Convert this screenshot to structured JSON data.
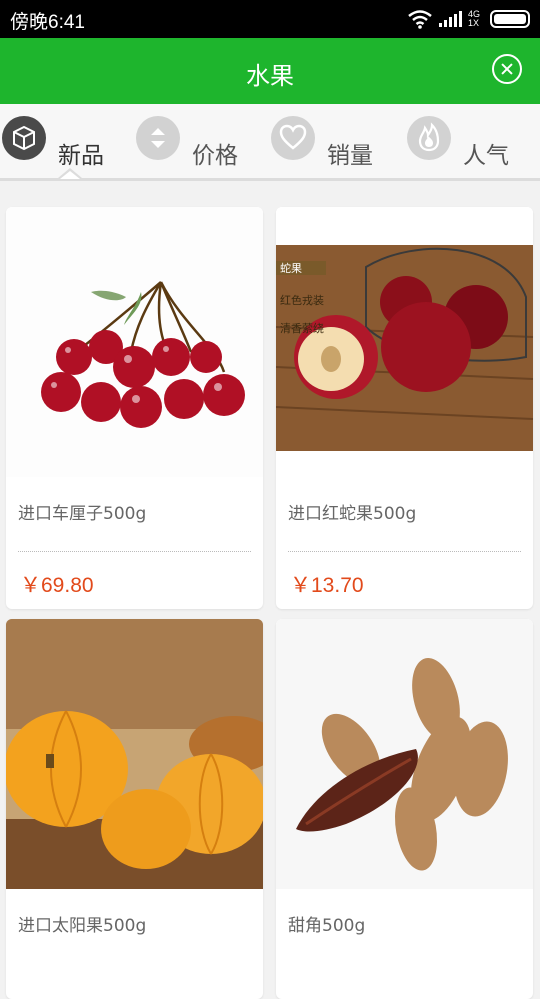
{
  "status_bar": {
    "time": "傍晚6:41",
    "network": "4G",
    "network_sub": "1X"
  },
  "header": {
    "title": "水果"
  },
  "tabs": [
    {
      "label": "新品",
      "icon": "box-icon",
      "active": true
    },
    {
      "label": "价格",
      "icon": "sort-arrows-icon",
      "active": false
    },
    {
      "label": "销量",
      "icon": "heart-icon",
      "active": false
    },
    {
      "label": "人气",
      "icon": "flame-icon",
      "active": false
    }
  ],
  "products": [
    {
      "name": "进口车厘子500g",
      "price": "￥69.80",
      "image": "cherries"
    },
    {
      "name": "进口红蛇果500g",
      "price": "￥13.70",
      "image": "red apples",
      "image_text": [
        "蛇果",
        "红色戎装",
        "清香萦绕"
      ]
    },
    {
      "name": "进口太阳果500g",
      "price": "",
      "image": "orange pumpkins"
    },
    {
      "name": "甜角500g",
      "price": "",
      "image": "tamarind pods"
    }
  ],
  "colors": {
    "accent": "#1eb52d",
    "price": "#e24a1b"
  }
}
